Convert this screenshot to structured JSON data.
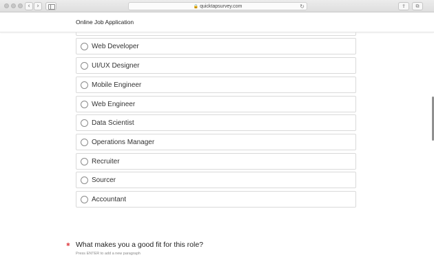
{
  "browser": {
    "url": "quicktapsurvey.com",
    "back_icon": "‹",
    "forward_icon": "›",
    "lock_icon": "🔒",
    "reload_icon": "↻",
    "share_icon": "⇪",
    "tabs_icon": "⧉"
  },
  "page": {
    "title": "Online Job Application"
  },
  "options": [
    {
      "label": "Web Developer"
    },
    {
      "label": "UI/UX Designer"
    },
    {
      "label": "Mobile Engineer"
    },
    {
      "label": "Web Engineer"
    },
    {
      "label": "Data Scientist"
    },
    {
      "label": "Operations Manager"
    },
    {
      "label": "Recruiter"
    },
    {
      "label": "Sourcer"
    },
    {
      "label": "Accountant"
    }
  ],
  "next_question": {
    "required_marker": "✱",
    "title": "What makes you a good fit for this role?",
    "hint": "Press ENTER to add a new paragraph"
  },
  "colors": {
    "required": "#e0464b",
    "border": "#d9d9d9"
  }
}
